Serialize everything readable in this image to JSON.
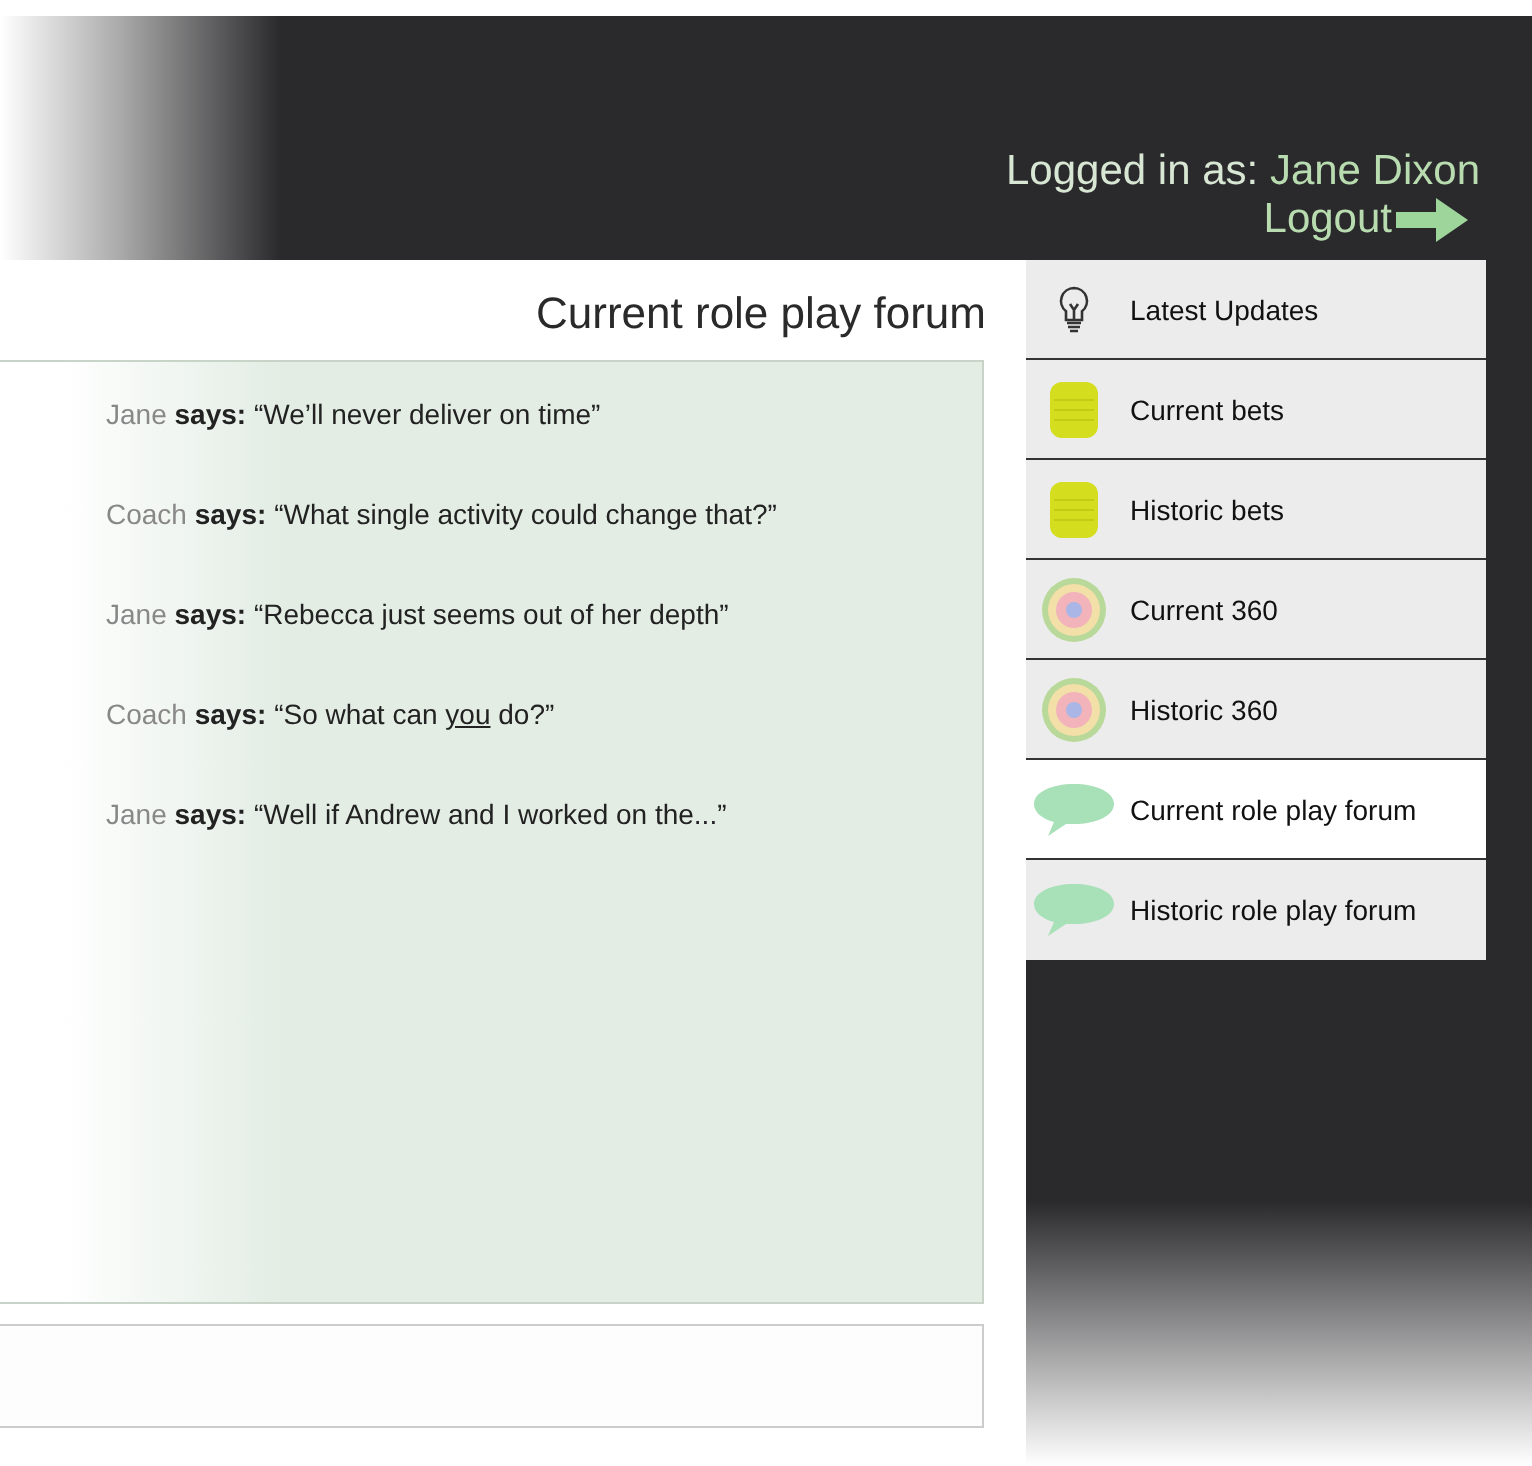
{
  "header": {
    "login_label": "Logged in as:",
    "user_name": "Jane Dixon",
    "logout": "Logout"
  },
  "forum": {
    "title": "Current role play forum",
    "messages": [
      {
        "speaker": "Jane",
        "verb": "says:",
        "parts": [
          {
            "text": "“We’ll never deliver on time”",
            "underlined": false
          }
        ]
      },
      {
        "speaker": "Coach",
        "verb": "says:",
        "parts": [
          {
            "text": "“What single activity could change that?”",
            "underlined": false
          }
        ]
      },
      {
        "speaker": "Jane",
        "verb": "says:",
        "parts": [
          {
            "text": "“Rebecca just seems out of her depth”",
            "underlined": false
          }
        ]
      },
      {
        "speaker": "Coach",
        "verb": "says:",
        "parts": [
          {
            "text": "“So what can ",
            "underlined": false
          },
          {
            "text": "you",
            "underlined": true
          },
          {
            "text": " do?”",
            "underlined": false
          }
        ]
      },
      {
        "speaker": "Jane",
        "verb": "says:",
        "parts": [
          {
            "text": "“Well if Andrew and I worked on the...”",
            "underlined": false
          }
        ]
      }
    ]
  },
  "menu": {
    "items": [
      {
        "label": "Latest Updates",
        "kind": "bulb",
        "selected": false
      },
      {
        "label": "Current bets",
        "kind": "database",
        "selected": false
      },
      {
        "label": "Historic bets",
        "kind": "database",
        "selected": false
      },
      {
        "label": "Current 360",
        "kind": "target",
        "selected": false
      },
      {
        "label": "Historic 360",
        "kind": "target",
        "selected": false
      },
      {
        "label": "Current role play forum",
        "kind": "speech",
        "selected": true
      },
      {
        "label": "Historic role play forum",
        "kind": "speech",
        "selected": false
      }
    ]
  }
}
